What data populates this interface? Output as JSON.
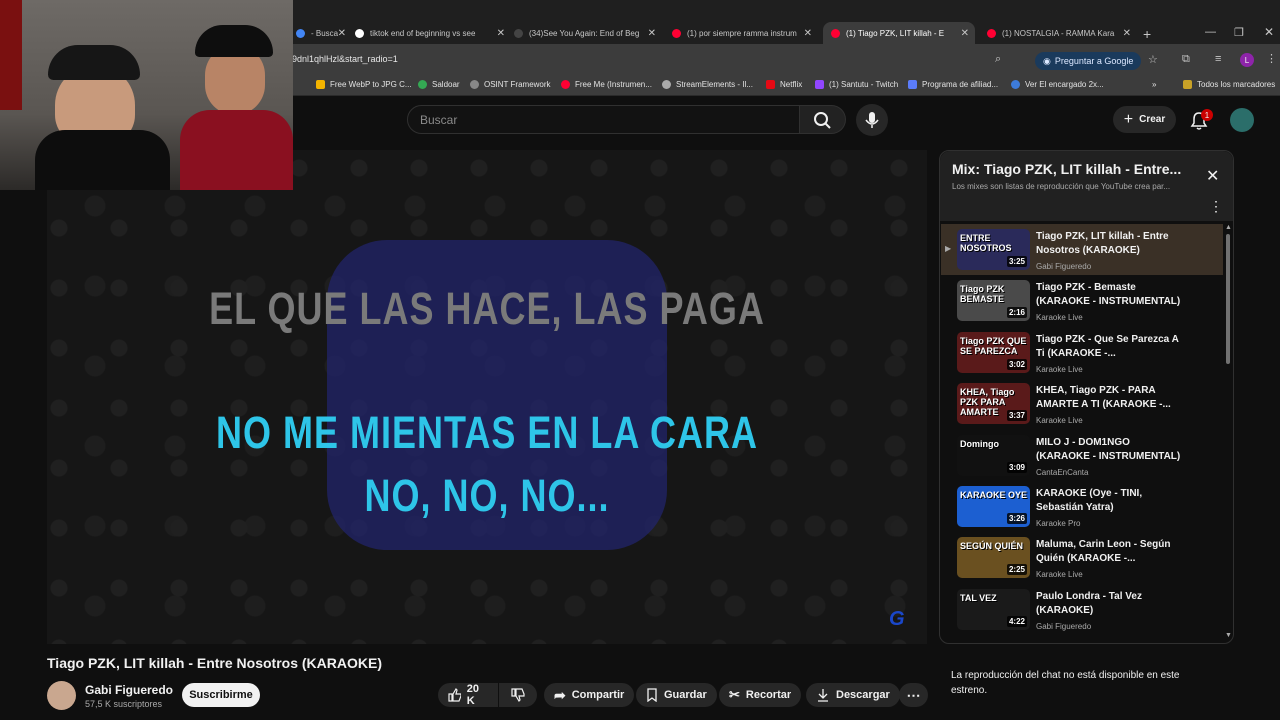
{
  "browser": {
    "tabs": [
      {
        "label": "- Busca",
        "fav": "#4285f4"
      },
      {
        "label": "tiktok end of beginning vs see",
        "fav": "#ffffff"
      },
      {
        "label": "(34)See You Again: End of Beg",
        "fav": "#111111"
      },
      {
        "label": "(1) por siempre ramma instrum",
        "fav": "#ff0033"
      },
      {
        "label": "(1) Tiago PZK, LIT killah - E",
        "fav": "#ff0033"
      },
      {
        "label": "(1) NOSTALGIA - RAMMA Kara",
        "fav": "#ff0033"
      }
    ],
    "url": "9dnl1qhlHzl&start_radio=1",
    "ask_google": "Preguntar a Google",
    "profile_letter": "L",
    "bookmarks": [
      "Free WebP to JPG C...",
      "Saldoar",
      "OSINT Framework",
      "Free Me (Instrumen...",
      "StreamElements - Il...",
      "Netflix",
      "(1) Santutu - Twitch",
      "Programa de afiliad...",
      "Ver El encargado 2x..."
    ],
    "bookmarks_all": "Todos los marcadores"
  },
  "header": {
    "search_placeholder": "Buscar",
    "create_label": "Crear",
    "notif_count": "1"
  },
  "video": {
    "lyric_line1": "EL QUE LAS HACE, LAS PAGA",
    "lyric_line2": "NO ME MIENTAS EN LA CARA",
    "lyric_line3": "NO, NO, NO...",
    "watermark": "G"
  },
  "meta": {
    "title": "Tiago PZK, LIT killah - Entre Nosotros (KARAOKE)",
    "channel": "Gabi Figueredo",
    "subscribers": "57,5 K suscriptores",
    "subscribe": "Suscribirme",
    "likes": "20 K",
    "share": "Compartir",
    "save": "Guardar",
    "clip": "Recortar",
    "download": "Descargar"
  },
  "playlist": {
    "title": "Mix: Tiago PZK, LIT killah - Entre...",
    "subtitle": "Los mixes son listas de reproducción que YouTube crea par...",
    "items": [
      {
        "title": "Tiago PZK, LIT killah - Entre Nosotros (KARAOKE)",
        "channel": "Gabi Figueredo",
        "duration": "3:25",
        "thumb": "ENTRE NOSOTROS",
        "bg": "#2a2a5a"
      },
      {
        "title": "Tiago PZK - Bemaste (KARAOKE - INSTRUMENTAL)",
        "channel": "Karaoke Live",
        "duration": "2:16",
        "thumb": "Tiago PZK BEMASTE",
        "bg": "#4a4a4a"
      },
      {
        "title": "Tiago PZK - Que Se Parezca A Ti (KARAOKE -...",
        "channel": "Karaoke Live",
        "duration": "3:02",
        "thumb": "Tiago PZK QUE SE PAREZCA",
        "bg": "#5a1a1a"
      },
      {
        "title": "KHEA, Tiago PZK - PARA AMARTE A TI (KARAOKE -...",
        "channel": "Karaoke Live",
        "duration": "3:37",
        "thumb": "KHEA, Tiago PZK PARA AMARTE",
        "bg": "#5a1a1a"
      },
      {
        "title": "MILO J - DOM1NGO (KARAOKE - INSTRUMENTAL)",
        "channel": "CantaEnCanta",
        "duration": "3:09",
        "thumb": "Domingo",
        "bg": "#111111"
      },
      {
        "title": "KARAOKE (Oye - TINI, Sebastián Yatra)",
        "channel": "Karaoke Pro",
        "duration": "3:26",
        "thumb": "KARAOKE OYE",
        "bg": "#1c5fd1"
      },
      {
        "title": "Maluma, Carin Leon - Según Quién (KARAOKE -...",
        "channel": "Karaoke Live",
        "duration": "2:25",
        "thumb": "SEGÚN QUIÉN",
        "bg": "#6a5020"
      },
      {
        "title": "Paulo Londra - Tal Vez (KARAOKE)",
        "channel": "Gabi Figueredo",
        "duration": "4:22",
        "thumb": "TAL VEZ",
        "bg": "#1a1a1a"
      }
    ]
  },
  "chat_note": "La reproducción del chat no está disponible en este estreno."
}
